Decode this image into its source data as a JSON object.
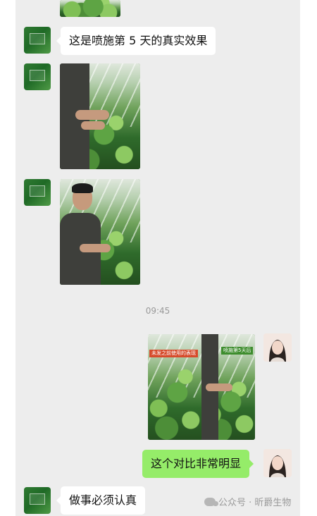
{
  "messages": {
    "msg1": "这是喷施第 5 天的真实效果",
    "msg2": "这个对比非常明显",
    "msg3": "做事必须认真"
  },
  "timestamp": "09:45",
  "comparison_labels": {
    "left": "未发之前使用的表现",
    "right": "喷施第5天后"
  },
  "watermark": {
    "text": "公众号 · 昕爵生物"
  },
  "colors": {
    "chat_bg": "#ededed",
    "incoming_bubble": "#ffffff",
    "outgoing_bubble": "#95ec69"
  }
}
